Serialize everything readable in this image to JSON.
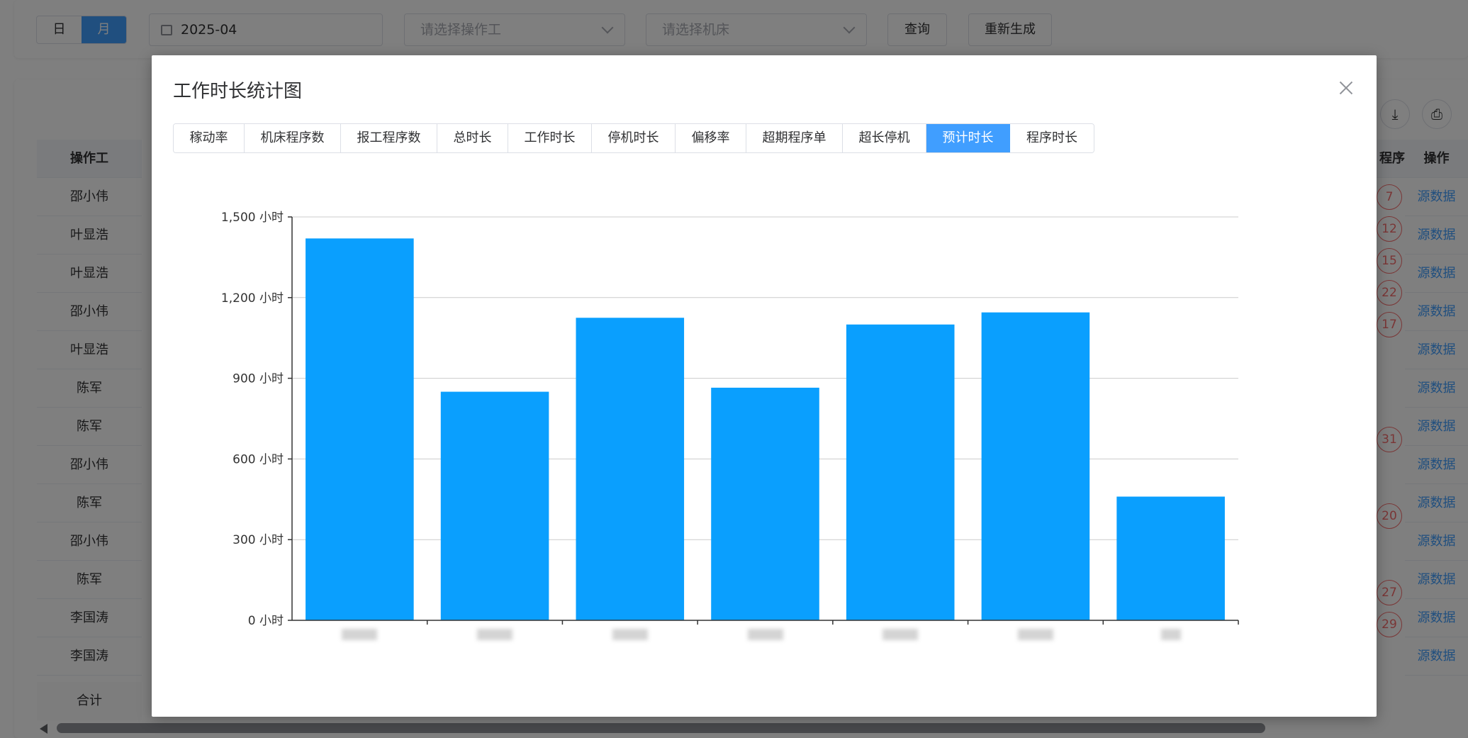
{
  "toolbar": {
    "period_toggle": [
      "日",
      "月"
    ],
    "period_active": "月",
    "date_value": "2025-04",
    "operator_placeholder": "请选择操作工",
    "machine_placeholder": "请选择机床",
    "query_label": "查询",
    "regenerate_label": "重新生成"
  },
  "table": {
    "header_operator": "操作工",
    "header_program_partial": "程序",
    "header_actions": "操作",
    "rows": [
      {
        "operator": "邵小伟",
        "badge": "7",
        "action": "源数据"
      },
      {
        "operator": "叶显浩",
        "badge": "12",
        "action": "源数据"
      },
      {
        "operator": "叶显浩",
        "badge": "15",
        "action": "源数据"
      },
      {
        "operator": "邵小伟",
        "badge": "22",
        "action": "源数据"
      },
      {
        "operator": "叶显浩",
        "badge": "17",
        "action": "源数据"
      },
      {
        "operator": "陈军",
        "badge": "",
        "action": "源数据"
      },
      {
        "operator": "陈军",
        "badge": "",
        "action": "源数据"
      },
      {
        "operator": "邵小伟",
        "badge": "31",
        "action": "源数据"
      },
      {
        "operator": "陈军",
        "badge": "",
        "action": "源数据"
      },
      {
        "operator": "邵小伟",
        "badge": "20",
        "action": "源数据"
      },
      {
        "operator": "陈军",
        "badge": "",
        "action": "源数据"
      },
      {
        "operator": "李国涛",
        "badge": "27",
        "action": "源数据"
      },
      {
        "operator": "李国涛",
        "badge": "29",
        "action": "源数据"
      }
    ],
    "total_label": "合计"
  },
  "dialog": {
    "title": "工作时长统计图",
    "tabs": [
      "稼动率",
      "机床程序数",
      "报工程序数",
      "总时长",
      "工作时长",
      "停机时长",
      "偏移率",
      "超期程序单",
      "超长停机",
      "预计时长",
      "程序时长"
    ],
    "active_tab": "预计时长"
  },
  "chart_data": {
    "type": "bar",
    "categories": [
      "",
      "",
      "",
      "",
      "",
      "",
      ""
    ],
    "values": [
      1420,
      850,
      1125,
      865,
      1100,
      1145,
      460
    ],
    "y_unit": "小时",
    "ylim": [
      0,
      1500
    ],
    "yticks": [
      0,
      300,
      600,
      900,
      1200,
      1500
    ],
    "ytick_labels": [
      "0 小时",
      "300 小时",
      "600 小时",
      "900 小时",
      "1,200 小时",
      "1,500 小时"
    ],
    "grid": true,
    "bar_color": "#0a9ffe",
    "category_labels_obscured": true
  },
  "colors": {
    "accent": "#409eff",
    "danger": "#f56c6c",
    "bar": "#0a9ffe"
  }
}
